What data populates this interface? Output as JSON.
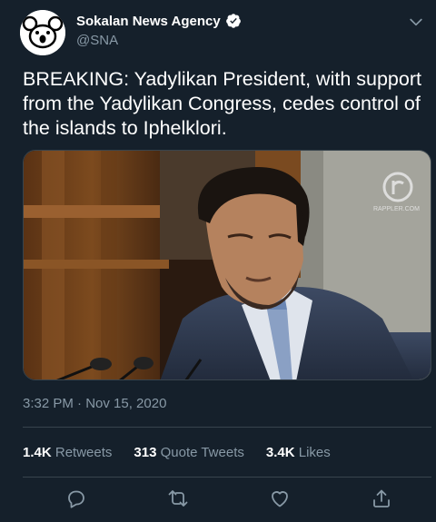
{
  "tweet": {
    "author_name": "Sokalan News Agency",
    "handle": "@SNA",
    "text": "BREAKING: Yadylikan President, with support from the Yadylikan Congress, cedes control of the islands to Iphelklori.",
    "timestamp": "3:32 PM · Nov 15, 2020",
    "media_watermark": "RAPPLER.COM",
    "stats": {
      "retweets": {
        "count": "1.4K",
        "label": "Retweets"
      },
      "quotes": {
        "count": "313",
        "label": "Quote Tweets"
      },
      "likes": {
        "count": "3.4K",
        "label": "Likes"
      }
    }
  },
  "icons": {
    "avatar": "koala-logo",
    "verified": "verified-badge-icon",
    "more": "chevron-down-icon",
    "reply": "reply-icon",
    "retweet": "retweet-icon",
    "like": "heart-icon",
    "share": "share-icon"
  },
  "colors": {
    "background": "#15202b",
    "secondary_text": "#8899a6",
    "divider": "#38444d"
  }
}
